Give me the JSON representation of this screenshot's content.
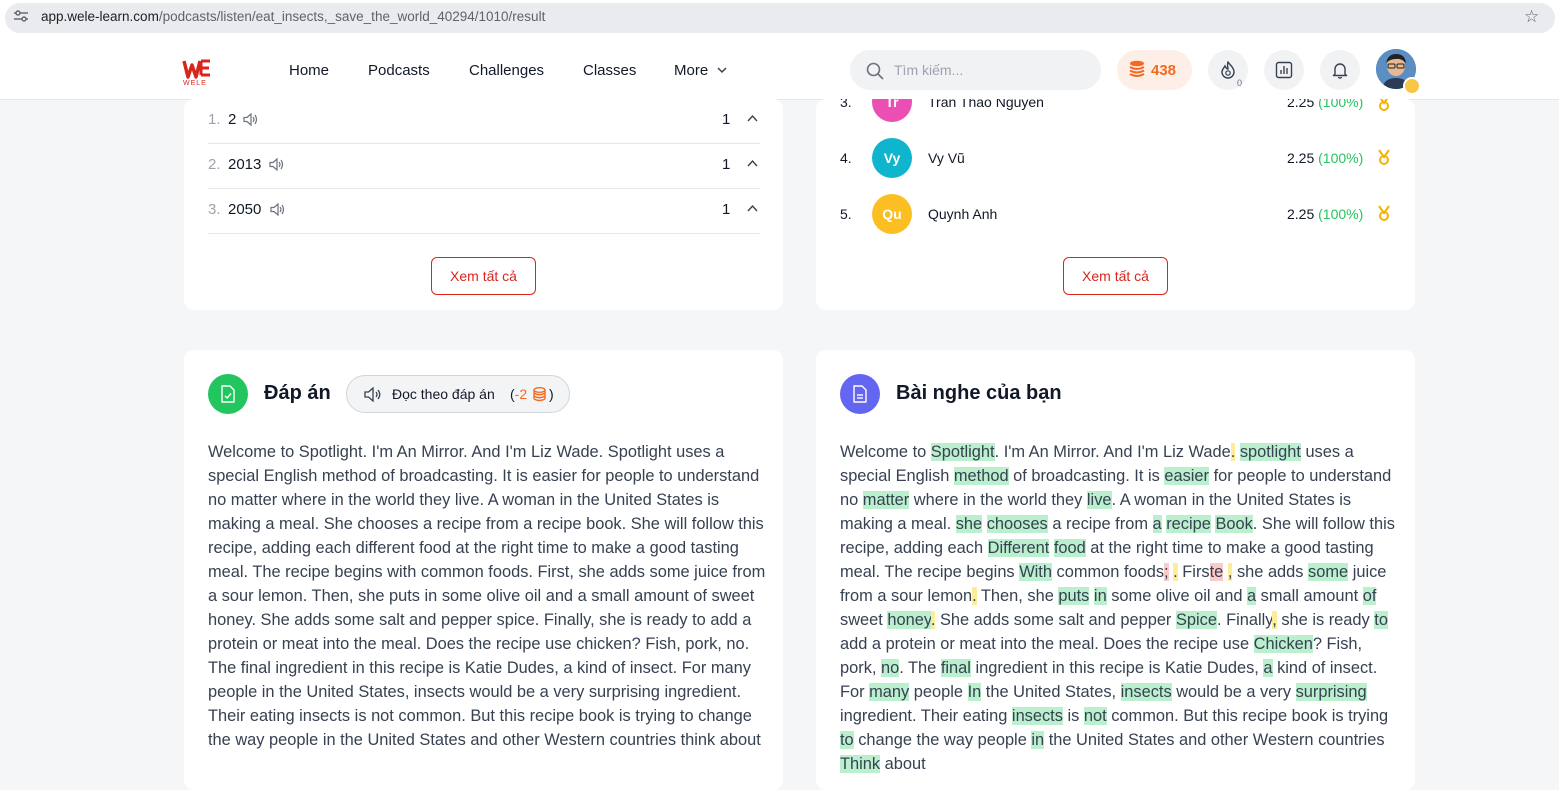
{
  "browser": {
    "url_host": "app.wele-learn.com",
    "url_path": "/podcasts/listen/eat_insects,_save_the_world_40294/1010/result"
  },
  "nav": {
    "logo_text": "WELE",
    "links": [
      "Home",
      "Podcasts",
      "Challenges",
      "Classes",
      "More"
    ],
    "search_placeholder": "Tìm kiếm...",
    "coins": "438",
    "streak_count": "0"
  },
  "answers_list": {
    "rows": [
      {
        "num": "1.",
        "value": "2",
        "count": "1"
      },
      {
        "num": "2.",
        "value": "2013",
        "count": "1"
      },
      {
        "num": "3.",
        "value": "2050",
        "count": "1"
      }
    ],
    "view_all": "Xem tất cả"
  },
  "leaderboard": {
    "rows": [
      {
        "rank": "3.",
        "initials": "Tr",
        "name": "Tran Thao Nguyen",
        "score": "2.25",
        "pct": "(100%)",
        "color": "#ec4fb4"
      },
      {
        "rank": "4.",
        "initials": "Vy",
        "name": "Vy Vũ",
        "score": "2.25",
        "pct": "(100%)",
        "color": "#0fb5cc"
      },
      {
        "rank": "5.",
        "initials": "Qu",
        "name": "Quynh Anh",
        "score": "2.25",
        "pct": "(100%)",
        "color": "#fbbf24"
      }
    ],
    "view_all": "Xem tất cả"
  },
  "answer_section": {
    "title": "Đáp án",
    "read_button": "Đọc theo đáp án",
    "read_cost_prefix": "(",
    "read_cost": "-2",
    "read_cost_suffix": ")",
    "text": "Welcome to Spotlight. I'm An Mirror. And I'm Liz Wade. Spotlight uses a special English method of broadcasting. It is easier for people to understand no matter where in the world they live. A woman in the United States is making a meal. She chooses a recipe from a recipe book. She will follow this recipe, adding each different food at the right time to make a good tasting meal. The recipe begins with common foods. First, she adds some juice from a sour lemon. Then, she puts in some olive oil and a small amount of sweet honey. She adds some salt and pepper spice. Finally, she is ready to add a protein or meat into the meal. Does the recipe use chicken? Fish, pork, no. The final ingredient in this recipe is Katie Dudes, a kind of insect. For many people in the United States, insects would be a very surprising ingredient. Their eating insects is not common. But this recipe book is trying to change the way people in the United States and other Western countries think about"
  },
  "user_section": {
    "title": "Bài nghe của bạn",
    "tokens": [
      [
        "Welcome to ",
        ""
      ],
      [
        "Spotlight",
        "g"
      ],
      [
        ". I'm An Mirror. And I'm Liz Wade",
        ""
      ],
      [
        ".",
        "y"
      ],
      [
        " ",
        ""
      ],
      [
        "spotlight",
        "g"
      ],
      [
        " uses a special English ",
        ""
      ],
      [
        "method",
        "g"
      ],
      [
        " of broadcasting. It is ",
        ""
      ],
      [
        "easier",
        "g"
      ],
      [
        " for people to understand no ",
        ""
      ],
      [
        "matter",
        "g"
      ],
      [
        " where in the world they ",
        ""
      ],
      [
        "live",
        "g"
      ],
      [
        ". A woman in the United States is making a meal. ",
        ""
      ],
      [
        "she",
        "g"
      ],
      [
        " ",
        ""
      ],
      [
        "chooses",
        "g"
      ],
      [
        " a recipe from ",
        ""
      ],
      [
        "a",
        "g"
      ],
      [
        " ",
        ""
      ],
      [
        "recipe",
        "g"
      ],
      [
        " ",
        ""
      ],
      [
        "Book",
        "g"
      ],
      [
        ". She will follow this recipe, adding each ",
        ""
      ],
      [
        "Different",
        "g"
      ],
      [
        " ",
        ""
      ],
      [
        "food",
        "g"
      ],
      [
        " at the right time to make a good tasting meal. The recipe begins ",
        ""
      ],
      [
        "With",
        "g"
      ],
      [
        " common foods",
        ""
      ],
      [
        ";",
        "r"
      ],
      [
        " ",
        ""
      ],
      [
        ".",
        "y"
      ],
      [
        " Firs",
        ""
      ],
      [
        "te",
        "r"
      ],
      [
        " ",
        ""
      ],
      [
        ",",
        "y"
      ],
      [
        " she adds ",
        ""
      ],
      [
        "some",
        "g"
      ],
      [
        " juice from a sour lemon",
        ""
      ],
      [
        ".",
        "y"
      ],
      [
        " Then, she ",
        ""
      ],
      [
        "puts",
        "g"
      ],
      [
        " ",
        ""
      ],
      [
        "in",
        "g"
      ],
      [
        " some olive oil and ",
        ""
      ],
      [
        "a",
        "g"
      ],
      [
        " small amount ",
        ""
      ],
      [
        "of",
        "g"
      ],
      [
        " sweet ",
        ""
      ],
      [
        "honey",
        "g"
      ],
      [
        ".",
        "y"
      ],
      [
        " She adds some salt and pepper ",
        ""
      ],
      [
        "Spice",
        "g"
      ],
      [
        ". Finally",
        ""
      ],
      [
        ",",
        "y"
      ],
      [
        " she is ready ",
        ""
      ],
      [
        "to",
        "g"
      ],
      [
        " add a protein or meat into the meal. Does the recipe use ",
        ""
      ],
      [
        "Chicken",
        "g"
      ],
      [
        "? Fish, pork, ",
        ""
      ],
      [
        "no",
        "g"
      ],
      [
        ". The ",
        ""
      ],
      [
        "final",
        "g"
      ],
      [
        " ingredient in this recipe is Katie Dudes, ",
        ""
      ],
      [
        "a",
        "g"
      ],
      [
        " kind of insect. For ",
        ""
      ],
      [
        "many",
        "g"
      ],
      [
        " people ",
        ""
      ],
      [
        "In",
        "g"
      ],
      [
        " the United States, ",
        ""
      ],
      [
        "insects",
        "g"
      ],
      [
        " would be a very ",
        ""
      ],
      [
        "surprising",
        "g"
      ],
      [
        " ingredient. Their eating ",
        ""
      ],
      [
        "insects",
        "g"
      ],
      [
        " is ",
        ""
      ],
      [
        "not",
        "g"
      ],
      [
        " common. But this recipe book is trying ",
        ""
      ],
      [
        "to",
        "g"
      ],
      [
        " change the way people ",
        ""
      ],
      [
        "in",
        "g"
      ],
      [
        " the United States and other Western countries ",
        ""
      ],
      [
        "Think",
        "g"
      ],
      [
        " about",
        ""
      ]
    ]
  },
  "colors": {
    "brand_red": "#d9261c",
    "coin_orange": "#f36a21",
    "match_green": "#bbf0cf",
    "punct_yellow": "#fdec9a",
    "wrong_red": "#fbcaca"
  }
}
